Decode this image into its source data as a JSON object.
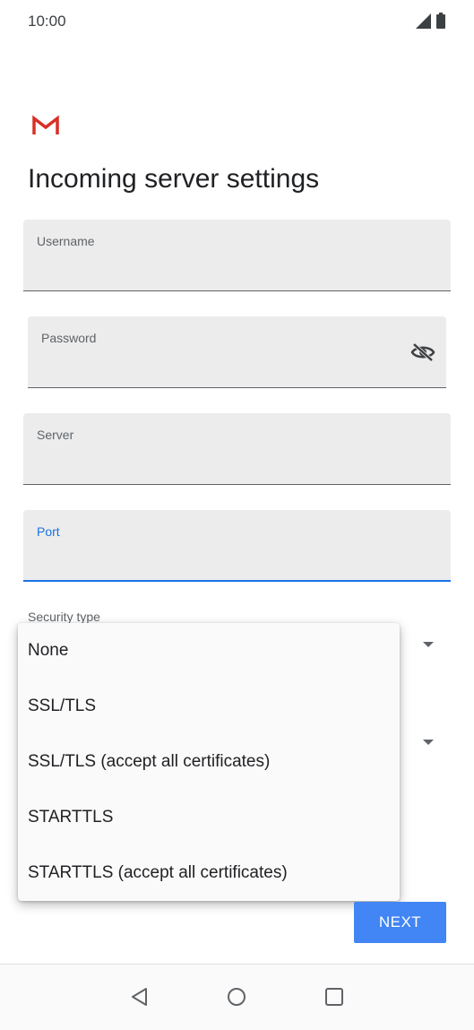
{
  "status_bar": {
    "time": "10:00"
  },
  "header": {
    "title": "Incoming server settings"
  },
  "fields": {
    "username": {
      "label": "Username",
      "value": ""
    },
    "password": {
      "label": "Password",
      "value": ""
    },
    "server": {
      "label": "Server",
      "value": ""
    },
    "port": {
      "label": "Port",
      "value": ""
    }
  },
  "security": {
    "label": "Security type",
    "options": [
      "None",
      "SSL/TLS",
      "SSL/TLS (accept all certificates)",
      "STARTTLS",
      "STARTTLS (accept all certificates)"
    ]
  },
  "footer": {
    "next_label": "NEXT"
  },
  "colors": {
    "accent": "#1a73e8",
    "button": "#4285f4",
    "field_bg": "#ececec",
    "gmail_red": "#d93025"
  },
  "icons": [
    "signal-icon",
    "battery-icon",
    "gmail-logo",
    "visibility-off-icon",
    "dropdown-arrow-icon",
    "back-icon",
    "home-icon",
    "recents-icon"
  ]
}
